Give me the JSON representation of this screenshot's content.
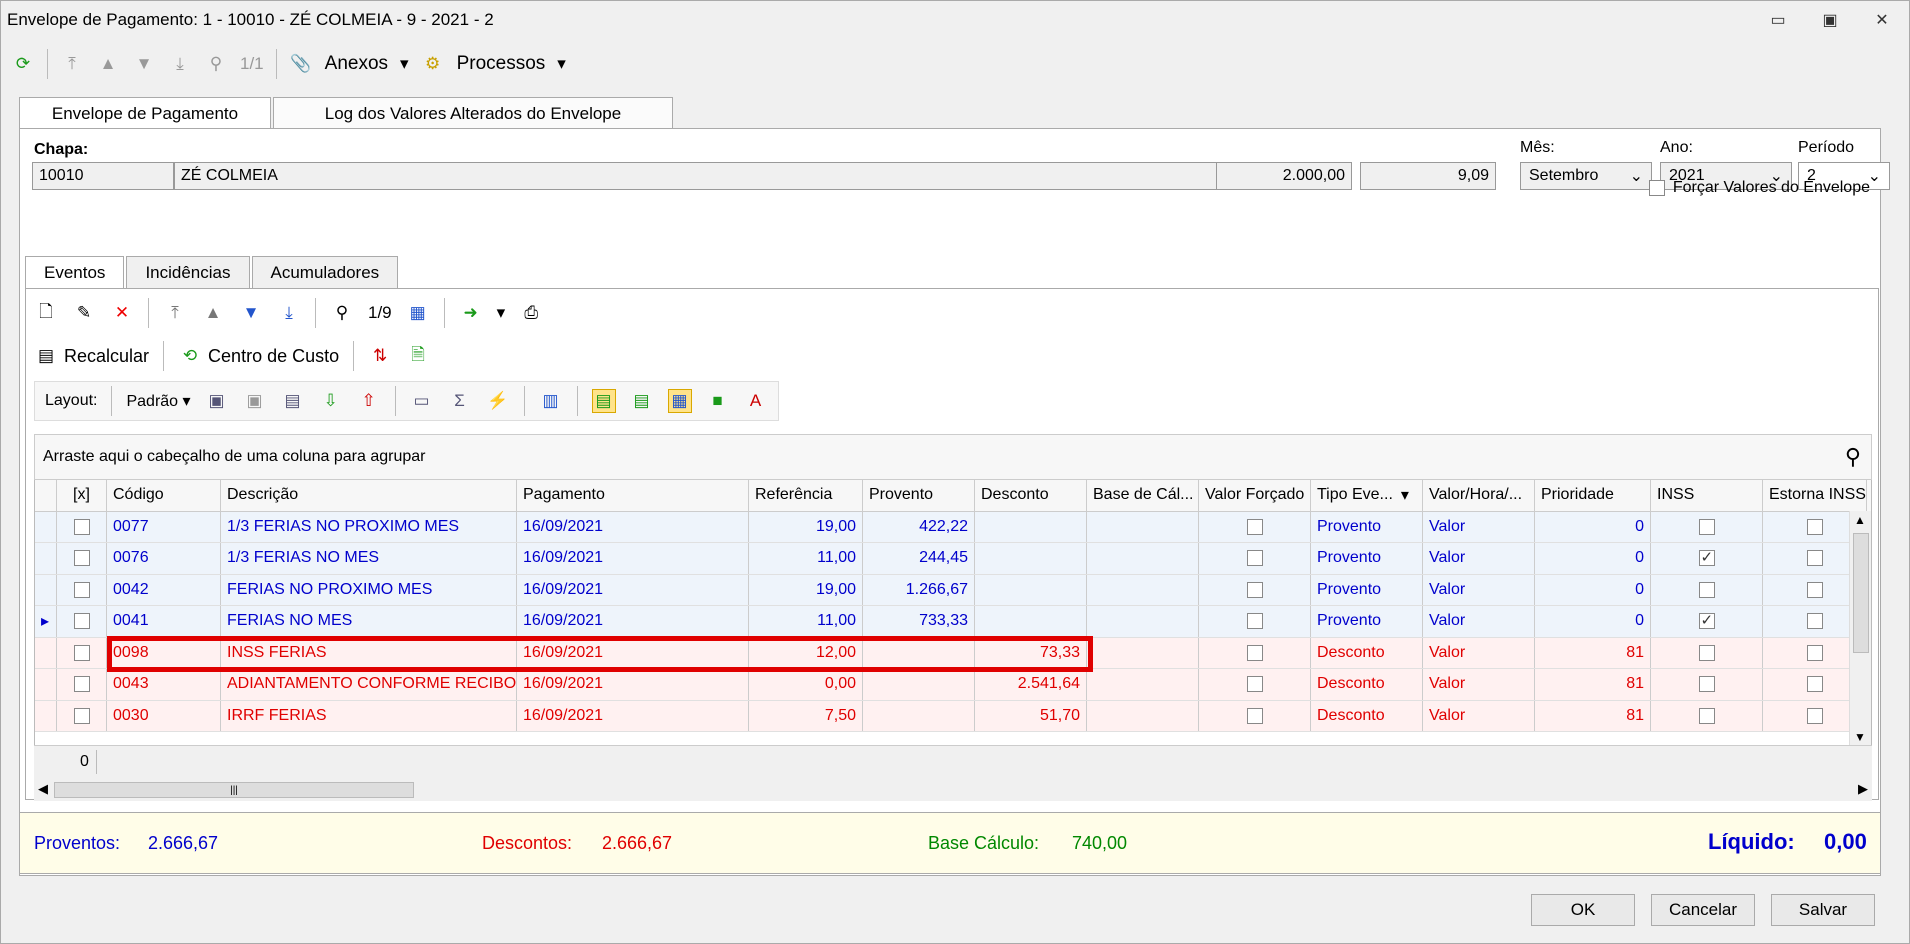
{
  "window": {
    "title": "Envelope de Pagamento: 1 - 10010 - ZÉ COLMEIA - 9 - 2021 - 2"
  },
  "toolbar": {
    "nav_count": "1/1",
    "anexos": "Anexos",
    "processos": "Processos"
  },
  "tabs": [
    "Envelope de Pagamento",
    "Log dos Valores Alterados do Envelope"
  ],
  "form": {
    "chapa_label": "Chapa:",
    "chapa": "10010",
    "nome": "ZÉ COLMEIA",
    "salario": "2.000,00",
    "valor_hora": "9,09",
    "mes_label": "Mês:",
    "mes": "Setembro",
    "ano_label": "Ano:",
    "ano": "2021",
    "periodo_label": "Período",
    "periodo": "2",
    "forcar_label": "Forçar Valores do Envelope"
  },
  "subtabs": [
    "Eventos",
    "Incidências",
    "Acumuladores"
  ],
  "events_toolbar": {
    "count": "1/9",
    "recalcular": "Recalcular",
    "centro_custo": "Centro de Custo",
    "layout": "Layout:",
    "padrao": "Padrão"
  },
  "grid": {
    "group_hint": "Arraste aqui o cabeçalho de uma coluna para agrupar",
    "headers": [
      "[x]",
      "Código",
      "Descrição",
      "Pagamento",
      "Referência",
      "Provento",
      "Desconto",
      "Base de Cál...",
      "Valor Forçado",
      "Tipo Eve...",
      "Valor/Hora/...",
      "Prioridade",
      "INSS",
      "Estorna INSS"
    ],
    "rows": [
      {
        "codigo": "0077",
        "descricao": "1/3 FERIAS NO PROXIMO MES",
        "pagamento": "16/09/2021",
        "referencia": "19,00",
        "provento": "422,22",
        "desconto": "",
        "tipo": "Provento",
        "valor": "Valor",
        "prioridade": "0",
        "inss": false
      },
      {
        "codigo": "0076",
        "descricao": "1/3 FERIAS NO MES",
        "pagamento": "16/09/2021",
        "referencia": "11,00",
        "provento": "244,45",
        "desconto": "",
        "tipo": "Provento",
        "valor": "Valor",
        "prioridade": "0",
        "inss": true
      },
      {
        "codigo": "0042",
        "descricao": "FERIAS NO PROXIMO MES",
        "pagamento": "16/09/2021",
        "referencia": "19,00",
        "provento": "1.266,67",
        "desconto": "",
        "tipo": "Provento",
        "valor": "Valor",
        "prioridade": "0",
        "inss": false
      },
      {
        "codigo": "0041",
        "descricao": "FERIAS NO MES",
        "pagamento": "16/09/2021",
        "referencia": "11,00",
        "provento": "733,33",
        "desconto": "",
        "tipo": "Provento",
        "valor": "Valor",
        "prioridade": "0",
        "inss": true
      },
      {
        "codigo": "0098",
        "descricao": "INSS FERIAS",
        "pagamento": "16/09/2021",
        "referencia": "12,00",
        "provento": "",
        "desconto": "73,33",
        "tipo": "Desconto",
        "valor": "Valor",
        "prioridade": "81",
        "inss": false
      },
      {
        "codigo": "0043",
        "descricao": "ADIANTAMENTO CONFORME RECIBO",
        "pagamento": "16/09/2021",
        "referencia": "0,00",
        "provento": "",
        "desconto": "2.541,64",
        "tipo": "Desconto",
        "valor": "Valor",
        "prioridade": "81",
        "inss": false
      },
      {
        "codigo": "0030",
        "descricao": "IRRF FERIAS",
        "pagamento": "16/09/2021",
        "referencia": "7,50",
        "provento": "",
        "desconto": "51,70",
        "tipo": "Desconto",
        "valor": "Valor",
        "prioridade": "81",
        "inss": false
      }
    ],
    "footer_count": "0"
  },
  "totals": {
    "proventos_label": "Proventos:",
    "proventos": "2.666,67",
    "descontos_label": "Descontos:",
    "descontos": "2.666,67",
    "base_label": "Base Cálculo:",
    "base": "740,00",
    "liquido_label": "Líquido:",
    "liquido": "0,00"
  },
  "buttons": {
    "ok": "OK",
    "cancelar": "Cancelar",
    "salvar": "Salvar"
  },
  "colors": {
    "provento": "#0000cc",
    "desconto": "#e00000",
    "base": "#008800",
    "highlight": "#e00000"
  }
}
